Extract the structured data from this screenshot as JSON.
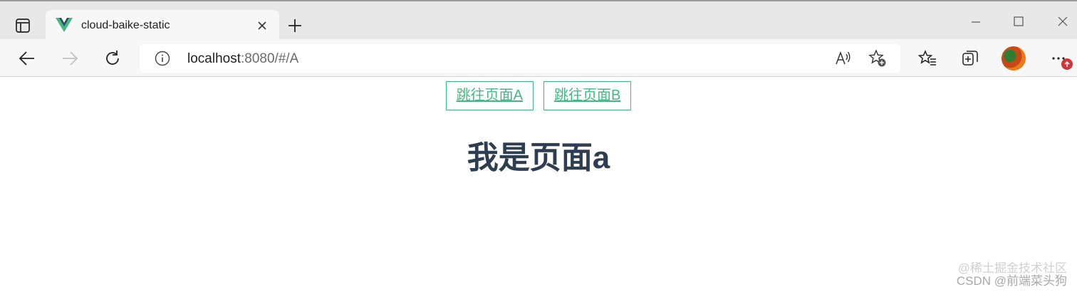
{
  "browser": {
    "tab": {
      "title": "cloud-baike-static"
    },
    "address": {
      "host": "localhost",
      "path": ":8080/#/A"
    },
    "colors": {
      "accent_vue": "#42b883",
      "vue_dark": "#35495e",
      "badge": "#d13438"
    },
    "icons": {
      "tab_actions": "tab-actions-icon",
      "favicon": "vue-logo-icon",
      "close": "close-icon",
      "new_tab": "plus-icon",
      "back": "back-arrow-icon",
      "forward": "forward-arrow-icon",
      "refresh": "refresh-icon",
      "site_info": "info-icon",
      "read_aloud": "read-aloud-icon",
      "add_favorite": "add-favorite-icon",
      "favorites": "favorites-icon",
      "collections": "collections-icon",
      "more": "more-icon"
    }
  },
  "page": {
    "links": [
      {
        "label": "跳往页面A"
      },
      {
        "label": "跳往页面B"
      }
    ],
    "heading": "我是页面a",
    "colors": {
      "link": "#42b983",
      "heading": "#2c3e50"
    }
  },
  "watermark": {
    "line1": "@稀土掘金技术社区",
    "line2": "CSDN @前端菜头狗"
  }
}
